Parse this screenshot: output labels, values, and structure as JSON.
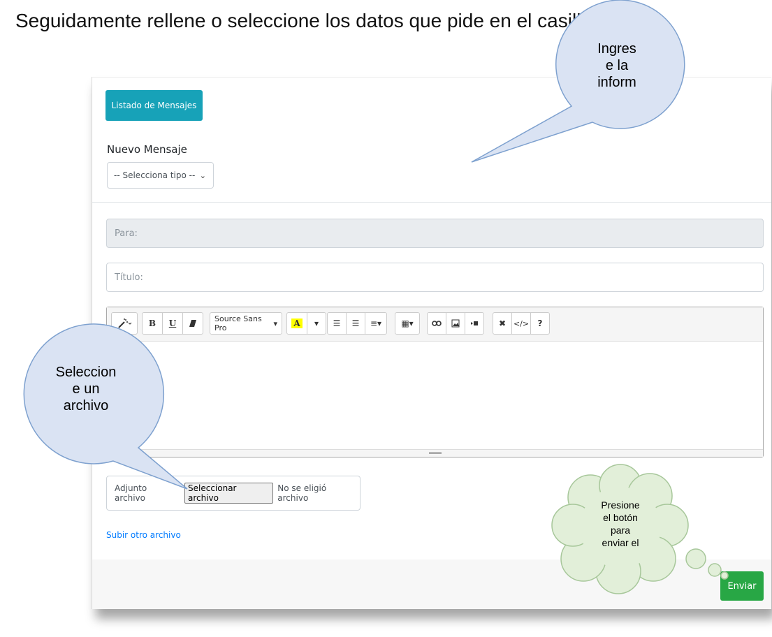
{
  "instruction": "Seguidamente rellene o seleccione los datos que pide en el casillero",
  "form": {
    "list_button": "Listado de Mensajes",
    "new_message_label": "Nuevo Mensaje",
    "type_select_value": "-- Selecciona tipo --",
    "to_placeholder": "Para:",
    "title_placeholder": "Título:",
    "editor_font": "Source Sans Pro",
    "attachment_label": "Adjunto archivo",
    "file_button": "Seleccionar archivo",
    "no_file_text": "No se eligió archivo",
    "upload_another_link": "Subir otro archivo",
    "send_button": "Enviar"
  },
  "toolbar_icons": [
    "magic-wand-icon",
    "bold-icon",
    "underline-icon",
    "eraser-icon",
    "font-family",
    "text-color-icon",
    "color-dropdown-icon",
    "unordered-list-icon",
    "ordered-list-icon",
    "paragraph-align-icon",
    "table-icon",
    "link-icon",
    "picture-icon",
    "video-icon",
    "fullscreen-icon",
    "code-view-icon",
    "help-icon"
  ],
  "callouts": {
    "top_lines": [
      "Ingres",
      "e la",
      "inform"
    ],
    "left_lines": [
      "Seleccion",
      "e un",
      "archivo"
    ],
    "cloud_lines": [
      "Presione",
      "el botón",
      "para",
      "enviar el"
    ]
  },
  "colors": {
    "list_button": "#17a2b8",
    "send_button": "#28a745",
    "link": "#007bff",
    "callout_blue": "#dae3f3",
    "callout_green": "#e2efd9"
  }
}
